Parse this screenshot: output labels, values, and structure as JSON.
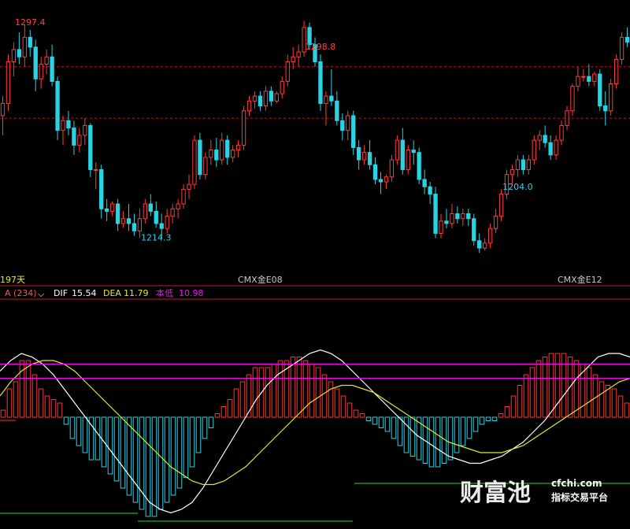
{
  "colors": {
    "background": "#000000",
    "up_candle": "#ff3c3c",
    "down_candle": "#28d4e4",
    "grid_dash": "#b01515",
    "separator": "#c81e1e",
    "dif_line": "#ffffff",
    "dea_line": "#e6e62e",
    "low_line": "#ff00ff",
    "macd_pos": "#ff3232",
    "macd_neg": "#28d4e4",
    "low_mark": "#22dd22",
    "high_label": "#ff4040",
    "low_label": "#30d0f0",
    "axis_text": "#c8c8c8",
    "days_text": "#e6e62e",
    "watermark": "#ffffff"
  },
  "header": {
    "days": "197天",
    "contract_1": "CMX金E08",
    "contract_2": "CMX金E12"
  },
  "indicator": {
    "name": "A (234)",
    "dropdown_icon": "chevron-down-icon",
    "dif_label": "DIF",
    "dif_value": "15.54",
    "dea_label": "DEA",
    "dea_value": "11.79",
    "low_label": "本低",
    "low_value": "10.98"
  },
  "watermark": {
    "brand": "财富池",
    "domain": "cfchi.com",
    "slogan": "指标交易平台"
  },
  "chart_data": [
    {
      "type": "candlestick",
      "title": "",
      "annotations": [
        {
          "label": "1297.4",
          "x_index": 5,
          "kind": "high"
        },
        {
          "label": "1298.8",
          "x_index": 58,
          "kind": "high"
        },
        {
          "label": "1214.3",
          "x_index": 28,
          "kind": "low"
        },
        {
          "label": "1204.0",
          "x_index": 94,
          "kind": "low"
        }
      ],
      "ohlc": [
        [
          1260,
          1268,
          1252,
          1265
        ],
        [
          1265,
          1285,
          1262,
          1282
        ],
        [
          1282,
          1290,
          1276,
          1287
        ],
        [
          1287,
          1294,
          1281,
          1284
        ],
        [
          1284,
          1297.4,
          1280,
          1292
        ],
        [
          1292,
          1295,
          1284,
          1288
        ],
        [
          1288,
          1291,
          1270,
          1275
        ],
        [
          1275,
          1284,
          1271,
          1281
        ],
        [
          1281,
          1287,
          1277,
          1284
        ],
        [
          1284,
          1289,
          1272,
          1274
        ],
        [
          1274,
          1276,
          1250,
          1254
        ],
        [
          1254,
          1260,
          1248,
          1258
        ],
        [
          1258,
          1262,
          1252,
          1255
        ],
        [
          1255,
          1258,
          1244,
          1248
        ],
        [
          1248,
          1255,
          1245,
          1252
        ],
        [
          1252,
          1259,
          1248,
          1256
        ],
        [
          1256,
          1257,
          1235,
          1238
        ],
        [
          1238,
          1241,
          1230,
          1238
        ],
        [
          1238,
          1240,
          1218,
          1222
        ],
        [
          1222,
          1226,
          1217,
          1221
        ],
        [
          1221,
          1225,
          1219,
          1224
        ],
        [
          1224,
          1226,
          1213,
          1216
        ],
        [
          1216,
          1221,
          1214.3,
          1218
        ],
        [
          1218,
          1224,
          1213,
          1216
        ],
        [
          1216,
          1220,
          1211,
          1213
        ],
        [
          1213,
          1222,
          1210,
          1218
        ],
        [
          1218,
          1226,
          1216,
          1224
        ],
        [
          1224,
          1228,
          1219,
          1221
        ],
        [
          1221,
          1225,
          1214.3,
          1216
        ],
        [
          1216,
          1220,
          1210,
          1214
        ],
        [
          1214,
          1222,
          1212,
          1219
        ],
        [
          1219,
          1224,
          1216,
          1222
        ],
        [
          1222,
          1226,
          1218,
          1224
        ],
        [
          1224,
          1232,
          1222,
          1230
        ],
        [
          1230,
          1236,
          1226,
          1232
        ],
        [
          1232,
          1252,
          1230,
          1250
        ],
        [
          1250,
          1253,
          1234,
          1236
        ],
        [
          1236,
          1245,
          1234,
          1243
        ],
        [
          1243,
          1250,
          1240,
          1246
        ],
        [
          1246,
          1251,
          1239,
          1242
        ],
        [
          1242,
          1253,
          1240,
          1250
        ],
        [
          1250,
          1252,
          1240,
          1243
        ],
        [
          1243,
          1248,
          1241,
          1246
        ],
        [
          1246,
          1250,
          1243,
          1248
        ],
        [
          1248,
          1264,
          1246,
          1262
        ],
        [
          1262,
          1268,
          1260,
          1266
        ],
        [
          1266,
          1270,
          1263,
          1268
        ],
        [
          1268,
          1270,
          1262,
          1264
        ],
        [
          1264,
          1272,
          1262,
          1270
        ],
        [
          1270,
          1272,
          1264,
          1266
        ],
        [
          1266,
          1270,
          1265,
          1269
        ],
        [
          1269,
          1276,
          1267,
          1274
        ],
        [
          1274,
          1285,
          1272,
          1282
        ],
        [
          1282,
          1288,
          1279,
          1284
        ],
        [
          1284,
          1289,
          1280,
          1286
        ],
        [
          1286,
          1298.8,
          1284,
          1296
        ],
        [
          1296,
          1298,
          1287,
          1289
        ],
        [
          1289,
          1292,
          1280,
          1282
        ],
        [
          1282,
          1285,
          1262,
          1265
        ],
        [
          1265,
          1270,
          1256,
          1268
        ],
        [
          1268,
          1279,
          1264,
          1266
        ],
        [
          1266,
          1270,
          1256,
          1258
        ],
        [
          1258,
          1261,
          1250,
          1254
        ],
        [
          1254,
          1262,
          1250,
          1260
        ],
        [
          1260,
          1262,
          1244,
          1247
        ],
        [
          1247,
          1250,
          1238,
          1242
        ],
        [
          1242,
          1248,
          1240,
          1245
        ],
        [
          1245,
          1250,
          1238,
          1240
        ],
        [
          1240,
          1243,
          1232,
          1234
        ],
        [
          1234,
          1237,
          1228,
          1233
        ],
        [
          1233,
          1236,
          1230,
          1235
        ],
        [
          1235,
          1244,
          1233,
          1242
        ],
        [
          1242,
          1252,
          1240,
          1250
        ],
        [
          1250,
          1255,
          1236,
          1238
        ],
        [
          1238,
          1248,
          1236,
          1246
        ],
        [
          1246,
          1250,
          1240,
          1245
        ],
        [
          1245,
          1247,
          1232,
          1234
        ],
        [
          1234,
          1238,
          1228,
          1231
        ],
        [
          1231,
          1233,
          1224,
          1228
        ],
        [
          1228,
          1231,
          1210,
          1212
        ],
        [
          1212,
          1220,
          1210,
          1217
        ],
        [
          1217,
          1222,
          1214,
          1216
        ],
        [
          1216,
          1224,
          1214,
          1220
        ],
        [
          1220,
          1223,
          1216,
          1218
        ],
        [
          1218,
          1222,
          1215,
          1220
        ],
        [
          1220,
          1222,
          1215,
          1218
        ],
        [
          1218,
          1220,
          1207,
          1209
        ],
        [
          1209,
          1212,
          1204.0,
          1206
        ],
        [
          1206,
          1210,
          1205,
          1208
        ],
        [
          1208,
          1216,
          1206,
          1214
        ],
        [
          1214,
          1222,
          1212,
          1219
        ],
        [
          1219,
          1230,
          1217,
          1228
        ],
        [
          1228,
          1238,
          1226,
          1236
        ],
        [
          1236,
          1240,
          1232,
          1238
        ],
        [
          1238,
          1244,
          1235,
          1242
        ],
        [
          1242,
          1244,
          1236,
          1238
        ],
        [
          1238,
          1244,
          1236,
          1242
        ],
        [
          1242,
          1252,
          1240,
          1250
        ],
        [
          1250,
          1254,
          1246,
          1252
        ],
        [
          1252,
          1256,
          1247,
          1249
        ],
        [
          1249,
          1252,
          1242,
          1244
        ],
        [
          1244,
          1252,
          1242,
          1250
        ],
        [
          1250,
          1258,
          1248,
          1256
        ],
        [
          1256,
          1264,
          1254,
          1262
        ],
        [
          1262,
          1273,
          1260,
          1272
        ],
        [
          1272,
          1280,
          1270,
          1276
        ],
        [
          1276,
          1279,
          1274,
          1276
        ],
        [
          1276,
          1281,
          1272,
          1274
        ],
        [
          1274,
          1278,
          1272,
          1277
        ],
        [
          1277,
          1279,
          1262,
          1264
        ],
        [
          1264,
          1270,
          1256,
          1262
        ],
        [
          1262,
          1275,
          1260,
          1273
        ],
        [
          1273,
          1285,
          1271,
          1283
        ],
        [
          1283,
          1294,
          1281,
          1292
        ],
        [
          1292,
          1296,
          1288,
          1290
        ]
      ],
      "price_range": [
        1198,
        1304
      ],
      "grid_lines": [
        1259,
        1280
      ]
    },
    {
      "type": "bar",
      "title": "",
      "ylim": [
        -30,
        30
      ],
      "series": [
        {
          "values": [
            2,
            8,
            10,
            16,
            16,
            12,
            8,
            6,
            5,
            4,
            -2,
            -6,
            -8,
            -10,
            -12,
            -12,
            -14,
            -16,
            -18,
            -20,
            -22,
            -24,
            -26,
            -28,
            -28,
            -26,
            -24,
            -22,
            -20,
            -17,
            -14,
            -10,
            -6,
            -3,
            1,
            3,
            5,
            8,
            10,
            12,
            14,
            14,
            14,
            15,
            16,
            16,
            17,
            17,
            16,
            15,
            14,
            12,
            10,
            8,
            6,
            4,
            2,
            1,
            -1,
            -2,
            -3,
            -4,
            -6,
            -8,
            -10,
            -11,
            -12,
            -13,
            -14,
            -14,
            -13,
            -12,
            -10,
            -8,
            -6,
            -4,
            -2,
            -1,
            -1,
            1,
            3,
            6,
            9,
            12,
            14,
            16,
            17,
            18,
            18,
            18,
            17,
            16,
            15,
            14,
            12,
            10,
            9,
            8,
            6,
            4
          ]
        },
        {
          "values": [
            13,
            16,
            18,
            17,
            15,
            12,
            8,
            4,
            0,
            -4,
            -8,
            -12,
            -16,
            -20,
            -24,
            -26,
            -27,
            -26,
            -24,
            -20,
            -15,
            -10,
            -5,
            0,
            5,
            9,
            12,
            14,
            16,
            18,
            19,
            18,
            16,
            13,
            10,
            7,
            4,
            1,
            -2,
            -5,
            -7,
            -9,
            -11,
            -12,
            -13,
            -13,
            -12,
            -11,
            -9,
            -7,
            -4,
            -1,
            3,
            7,
            11,
            14,
            17,
            18,
            18,
            17
          ]
        },
        {
          "values": [
            6,
            10,
            13,
            15,
            16,
            16,
            15,
            13,
            10,
            7,
            4,
            1,
            -2,
            -5,
            -8,
            -11,
            -14,
            -16,
            -18,
            -19,
            -19,
            -18,
            -16,
            -14,
            -11,
            -8,
            -5,
            -2,
            1,
            4,
            6,
            8,
            9,
            9,
            8,
            7,
            5,
            3,
            1,
            -1,
            -3,
            -5,
            -7,
            -8,
            -9,
            -10,
            -10,
            -10,
            -9,
            -8,
            -6,
            -4,
            -2,
            0,
            2,
            4,
            6,
            8,
            10,
            11
          ]
        }
      ],
      "ref_values": [
        15.0,
        11.0
      ]
    }
  ]
}
